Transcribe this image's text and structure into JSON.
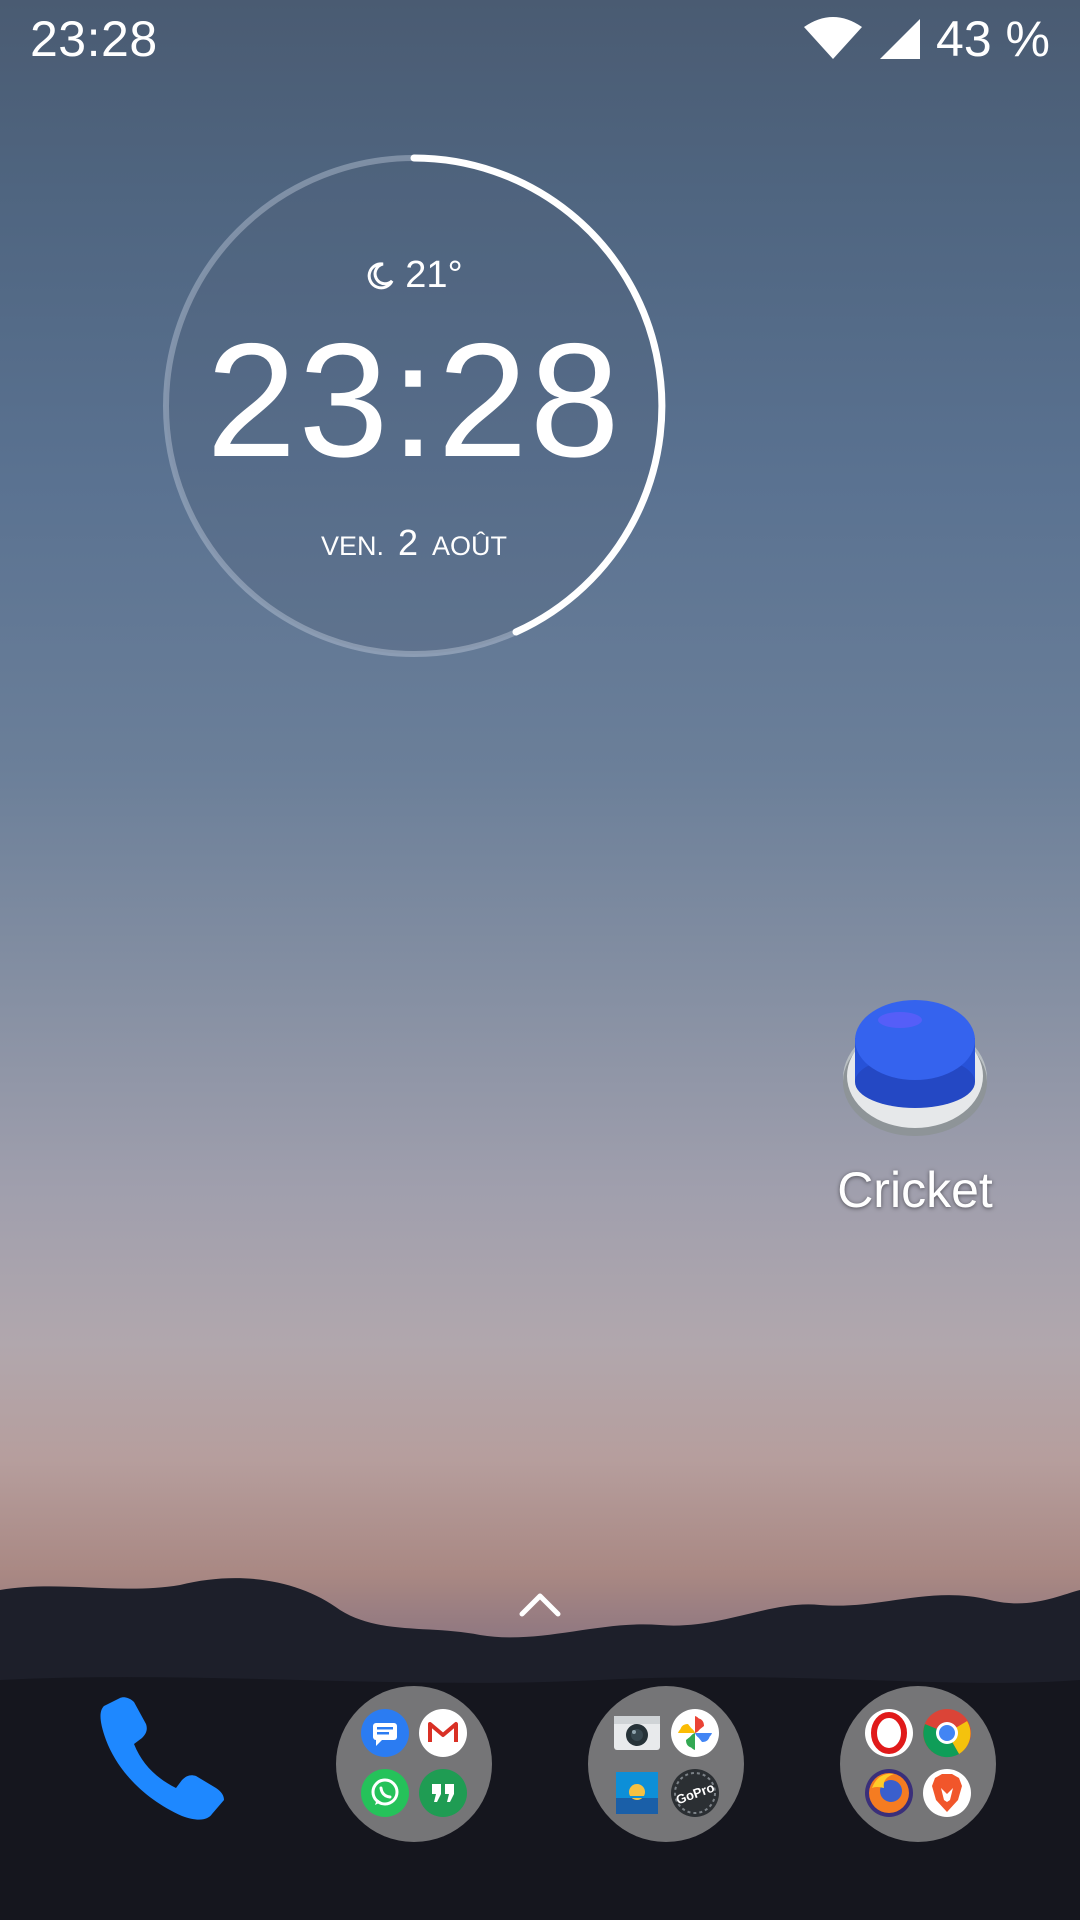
{
  "status_bar": {
    "time": "23:28",
    "battery": "43 %",
    "icons": [
      "wifi-icon",
      "cell-signal-icon"
    ]
  },
  "clock_widget": {
    "weather_icon": "moon-icon",
    "temperature": "21°",
    "time": "23:28",
    "day": "VEN.",
    "date": "2",
    "month": "AOÛT"
  },
  "desktop": {
    "apps": [
      {
        "label": "Cricket",
        "icon": "blue-button-icon"
      }
    ]
  },
  "dock": {
    "phone_icon": "phone-icon",
    "folders": [
      {
        "icons": [
          "messages-icon",
          "gmail-icon",
          "whatsapp-icon",
          "hangouts-icon"
        ]
      },
      {
        "icons": [
          "camera-icon",
          "photos-icon",
          "gallery-icon",
          "gopro-icon"
        ]
      },
      {
        "icons": [
          "opera-icon",
          "chrome-icon",
          "firefox-icon",
          "brave-icon"
        ]
      }
    ]
  },
  "colors": {
    "accent_blue": "#1e88ff",
    "white": "#ffffff"
  }
}
